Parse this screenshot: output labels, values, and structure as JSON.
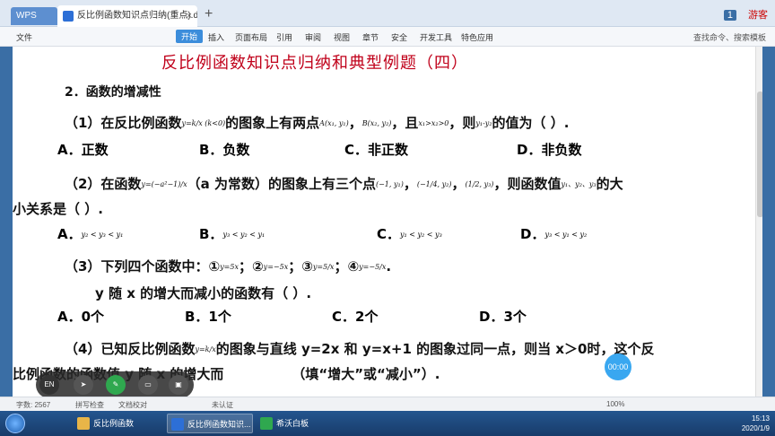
{
  "window": {
    "wps_label": "WPS",
    "doc_tab_title": "反比例函数知识点归纳(重点).docx",
    "doc_tab_close": "×",
    "new_tab": "+",
    "badge": "1",
    "user": "游客"
  },
  "ribbon": {
    "file": "文件",
    "tabs": [
      "开始",
      "插入",
      "页面布局",
      "引用",
      "审阅",
      "视图",
      "章节",
      "安全",
      "开发工具",
      "特色应用"
    ],
    "search": "查找命令、搜索模板"
  },
  "document": {
    "title": "反比例函数知识点归纳和典型例题（四）",
    "section": "2．函数的增减性",
    "q1": {
      "text_a": "（1）在反比例函数",
      "fn": "y=k/x (k<0)",
      "text_b": "的图象上有两点",
      "pa": "A(x₁, y₁)",
      "sep": "，",
      "pb": "B(x₂, y₂)",
      "text_c": "，且",
      "cond": "x₁>x₂>0",
      "text_d": "，则",
      "expr": "y₁-y₂",
      "text_e": "的值为（  ）.",
      "options": [
        "A．正数",
        "B．负数",
        "C．非正数",
        "D．非负数"
      ]
    },
    "q2": {
      "text_a": "（2）在函数",
      "fn": "y=(−a²−1)/x",
      "text_b": "（a 为常数）的图象上有三个点",
      "p1": "(−1, y₁)",
      "p2": "(−1/4, y₂)",
      "p3": "(1/2, y₃)",
      "text_c": "，则函数值",
      "vals": "y₁、y₂、y₃",
      "text_d": "的大",
      "text_e": "小关系是（  ）.",
      "options": [
        {
          "letter": "A．",
          "expr": "y₂ < y₃ < y₁"
        },
        {
          "letter": "B．",
          "expr": "y₃ < y₂ < y₁"
        },
        {
          "letter": "C．",
          "expr": "y₁ < y₂ < y₃"
        },
        {
          "letter": "D．",
          "expr": "y₃ < y₁ < y₂"
        }
      ]
    },
    "q3": {
      "text_a": "（3）下列四个函数中：①",
      "f1": "y=5x",
      "t2": "；②",
      "f2": "y=−5x",
      "t3": "；③",
      "f3": "y=5/x",
      "t4": "；④",
      "f4": "y=−5/x",
      "t5": ".",
      "line2": "y 随 x 的增大而减小的函数有（  ）.",
      "options": [
        "A．0个",
        "B．1个",
        "C．2个",
        "D．3个"
      ]
    },
    "q4": {
      "text_a": "（4）已知反比例函数",
      "fn": "y=k/x",
      "text_b": "的图象与直线 y=2x 和 y=x+1 的图象过同一点，则当 x＞0时，这个反",
      "line2_a": "比例函数的函数值 y 随 x 的增大而",
      "line2_b": "（填“增大”或“减小”）."
    }
  },
  "status": {
    "wordcount": "字数: 2567",
    "spell": "拼写检查",
    "proof": "文档校对",
    "cert": "未认证",
    "zoom": "100%"
  },
  "floating_toolbar": {
    "btn1": "EN"
  },
  "timer": "00:00",
  "taskbar": {
    "items": [
      "反比例函数",
      "反比例函数知识...",
      "希沃白板"
    ],
    "time": "15:13",
    "date": "2020/1/9"
  }
}
